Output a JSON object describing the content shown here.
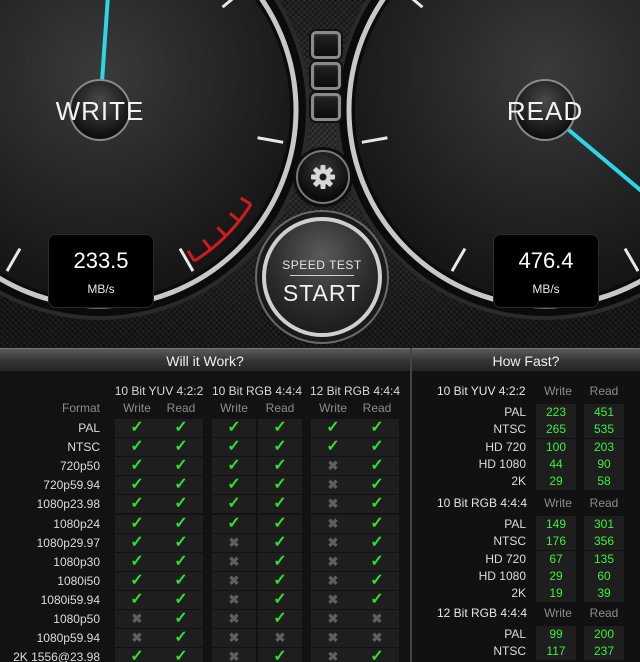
{
  "gauges": {
    "write": {
      "label": "WRITE",
      "value": "233.5",
      "unit": "MB/s"
    },
    "read": {
      "label": "READ",
      "value": "476.4",
      "unit": "MB/s"
    }
  },
  "start_button": {
    "small": "SPEED TEST",
    "big": "START"
  },
  "icons": [
    "gear-icon",
    "checkmark-icon",
    "cross-icon"
  ],
  "colors": {
    "needle": "#2bd6e6",
    "redline": "#d21c1c",
    "ok": "#2fe02f",
    "no": "#5f5f5f",
    "number": "#3cf03c"
  },
  "will_it_work": {
    "title": "Will it Work?",
    "format_header": "Format",
    "groups": [
      {
        "label": "10 Bit YUV 4:2:2",
        "write": "Write",
        "read": "Read"
      },
      {
        "label": "10 Bit RGB 4:4:4",
        "write": "Write",
        "read": "Read"
      },
      {
        "label": "12 Bit RGB 4:4:4",
        "write": "Write",
        "read": "Read"
      }
    ],
    "rows": [
      {
        "format": "PAL",
        "marks": [
          1,
          1,
          1,
          1,
          1,
          1
        ]
      },
      {
        "format": "NTSC",
        "marks": [
          1,
          1,
          1,
          1,
          1,
          1
        ]
      },
      {
        "format": "720p50",
        "marks": [
          1,
          1,
          1,
          1,
          0,
          1
        ]
      },
      {
        "format": "720p59.94",
        "marks": [
          1,
          1,
          1,
          1,
          0,
          1
        ]
      },
      {
        "format": "1080p23.98",
        "marks": [
          1,
          1,
          1,
          1,
          0,
          1
        ]
      },
      {
        "format": "1080p24",
        "marks": [
          1,
          1,
          1,
          1,
          0,
          1
        ]
      },
      {
        "format": "1080p29.97",
        "marks": [
          1,
          1,
          0,
          1,
          0,
          1
        ]
      },
      {
        "format": "1080p30",
        "marks": [
          1,
          1,
          0,
          1,
          0,
          1
        ]
      },
      {
        "format": "1080i50",
        "marks": [
          1,
          1,
          0,
          1,
          0,
          1
        ]
      },
      {
        "format": "1080i59.94",
        "marks": [
          1,
          1,
          0,
          1,
          0,
          1
        ]
      },
      {
        "format": "1080p50",
        "marks": [
          0,
          1,
          0,
          1,
          0,
          0
        ]
      },
      {
        "format": "1080p59.94",
        "marks": [
          0,
          1,
          0,
          0,
          0,
          0
        ]
      },
      {
        "format": "2K 1556@23.98",
        "marks": [
          1,
          1,
          0,
          1,
          0,
          1
        ]
      }
    ]
  },
  "how_fast": {
    "title": "How Fast?",
    "sections": [
      {
        "label": "10 Bit YUV 4:2:2",
        "write": "Write",
        "read": "Read",
        "rows": [
          {
            "format": "PAL",
            "write": "223",
            "read": "451"
          },
          {
            "format": "NTSC",
            "write": "265",
            "read": "535"
          },
          {
            "format": "HD 720",
            "write": "100",
            "read": "203"
          },
          {
            "format": "HD 1080",
            "write": "44",
            "read": "90"
          },
          {
            "format": "2K",
            "write": "29",
            "read": "58"
          }
        ]
      },
      {
        "label": "10 Bit RGB 4:4:4",
        "write": "Write",
        "read": "Read",
        "rows": [
          {
            "format": "PAL",
            "write": "149",
            "read": "301"
          },
          {
            "format": "NTSC",
            "write": "176",
            "read": "356"
          },
          {
            "format": "HD 720",
            "write": "67",
            "read": "135"
          },
          {
            "format": "HD 1080",
            "write": "29",
            "read": "60"
          },
          {
            "format": "2K",
            "write": "19",
            "read": "39"
          }
        ]
      },
      {
        "label": "12 Bit RGB 4:4:4",
        "write": "Write",
        "read": "Read",
        "rows": [
          {
            "format": "PAL",
            "write": "99",
            "read": "200"
          },
          {
            "format": "NTSC",
            "write": "117",
            "read": "237"
          }
        ]
      }
    ]
  }
}
